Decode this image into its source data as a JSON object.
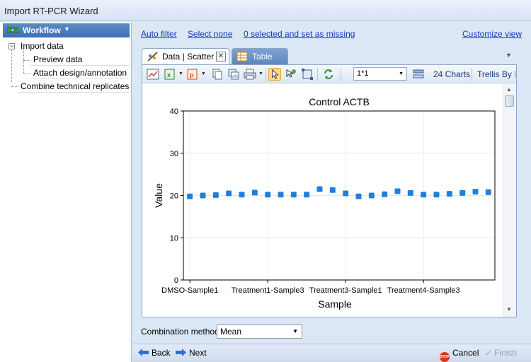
{
  "window": {
    "title": "Import RT-PCR Wizard"
  },
  "workflow": {
    "header_label": "Workflow",
    "steps": [
      {
        "label": "Import data",
        "expanded": true,
        "children": [
          {
            "label": "Preview data"
          },
          {
            "label": "Attach design/annotation"
          }
        ]
      },
      {
        "label": "Combine technical replicates"
      }
    ]
  },
  "links": {
    "auto_filter": "Auto filter",
    "select_none": "Select none",
    "selected_missing": "0 selected and set as missing",
    "customize_view": "Customize view"
  },
  "tabs": [
    {
      "label": "Data | Scatter",
      "active": true,
      "close": "✕"
    },
    {
      "label": "Table",
      "active": false
    }
  ],
  "toolbar": {
    "combo_value": "1*1",
    "charts_label": "24 Charts",
    "trellis_label": "Trellis By I"
  },
  "chart_data": {
    "type": "scatter",
    "title": "Control ACTB",
    "xlabel": "Sample",
    "ylabel": "Value",
    "ylim": [
      0,
      40
    ],
    "yticks": [
      0,
      10,
      20,
      30,
      40
    ],
    "x_tick_labels": [
      "DMSO-Sample1",
      "Treatment1-Sample3",
      "Treatment3-Sample1",
      "Treatment4-Sample3"
    ],
    "x_tick_label_positions": [
      1,
      7,
      13,
      19
    ],
    "xlim": [
      0.5,
      24.5
    ],
    "grid": true,
    "marker_color": "#1f7fe0",
    "series": [
      {
        "x": [
          1,
          2,
          3,
          4,
          5,
          6,
          7,
          8,
          9,
          10,
          11,
          12,
          13,
          14,
          15,
          16,
          17,
          18,
          19,
          20,
          21,
          22,
          23,
          24
        ],
        "values": [
          19.8,
          20.0,
          20.1,
          20.5,
          20.2,
          20.7,
          20.2,
          20.2,
          20.2,
          20.2,
          21.5,
          21.3,
          20.5,
          19.8,
          20.0,
          20.3,
          21.0,
          20.6,
          20.2,
          20.2,
          20.4,
          20.6,
          20.9,
          20.8
        ]
      }
    ]
  },
  "combination": {
    "label": "Combination method",
    "value": "Mean"
  },
  "navigation": {
    "back": "Back",
    "next": "Next",
    "cancel": "Cancel",
    "finish": "Finish",
    "stop_icon_text": "STOP"
  }
}
